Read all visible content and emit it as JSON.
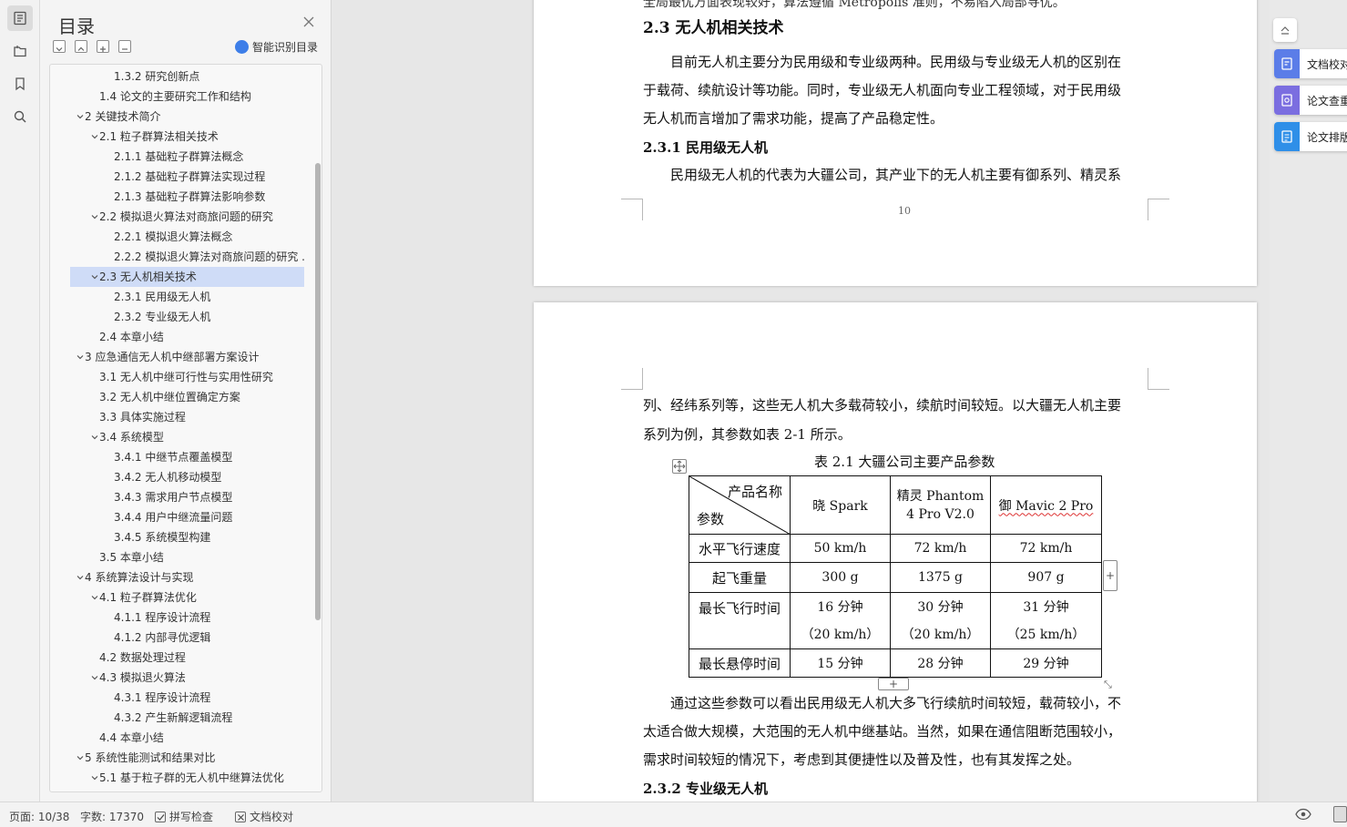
{
  "toc": {
    "title": "目录",
    "smart_label": "智能识别目录",
    "items": [
      {
        "text": "1.3.2 研究创新点",
        "level": 3,
        "arrow": ""
      },
      {
        "text": "1.4 论文的主要研究工作和结构",
        "level": 2,
        "arrow": ""
      },
      {
        "text": "2 关键技术简介",
        "level": 1,
        "arrow": "v"
      },
      {
        "text": "2.1 粒子群算法相关技术",
        "level": 2,
        "arrow": "v"
      },
      {
        "text": "2.1.1 基础粒子群算法概念",
        "level": 3,
        "arrow": ""
      },
      {
        "text": "2.1.2 基础粒子群算法实现过程",
        "level": 3,
        "arrow": ""
      },
      {
        "text": "2.1.3 基础粒子群算法影响参数",
        "level": 3,
        "arrow": ""
      },
      {
        "text": "2.2 模拟退火算法对商旅问题的研究",
        "level": 2,
        "arrow": "v"
      },
      {
        "text": "2.2.1 模拟退火算法概念",
        "level": 3,
        "arrow": ""
      },
      {
        "text": "2.2.2 模拟退火算法对商旅问题的研究 ...",
        "level": 3,
        "arrow": ""
      },
      {
        "text": "2.3 无人机相关技术",
        "level": 2,
        "arrow": "v",
        "active": true
      },
      {
        "text": "2.3.1 民用级无人机",
        "level": 3,
        "arrow": ""
      },
      {
        "text": "2.3.2 专业级无人机",
        "level": 3,
        "arrow": ""
      },
      {
        "text": "2.4 本章小结",
        "level": 2,
        "arrow": ""
      },
      {
        "text": "3 应急通信无人机中继部署方案设计",
        "level": 1,
        "arrow": "v"
      },
      {
        "text": "3.1 无人机中继可行性与实用性研究",
        "level": 2,
        "arrow": ""
      },
      {
        "text": "3.2 无人机中继位置确定方案",
        "level": 2,
        "arrow": ""
      },
      {
        "text": "3.3 具体实施过程",
        "level": 2,
        "arrow": ""
      },
      {
        "text": "3.4 系统模型",
        "level": 2,
        "arrow": "v"
      },
      {
        "text": "3.4.1  中继节点覆盖模型",
        "level": 3,
        "arrow": ""
      },
      {
        "text": "3.4.2 无人机移动模型",
        "level": 3,
        "arrow": ""
      },
      {
        "text": "3.4.3 需求用户节点模型",
        "level": 3,
        "arrow": ""
      },
      {
        "text": "3.4.4  用户中继流量问题",
        "level": 3,
        "arrow": ""
      },
      {
        "text": "3.4.5   系统模型构建",
        "level": 3,
        "arrow": ""
      },
      {
        "text": "3.5 本章小结",
        "level": 2,
        "arrow": ""
      },
      {
        "text": "4 系统算法设计与实现",
        "level": 1,
        "arrow": "v"
      },
      {
        "text": "4.1 粒子群算法优化",
        "level": 2,
        "arrow": "v"
      },
      {
        "text": "4.1.1 程序设计流程",
        "level": 3,
        "arrow": ""
      },
      {
        "text": "4.1.2    内部寻优逻辑",
        "level": 3,
        "arrow": ""
      },
      {
        "text": "4.2 数据处理过程",
        "level": 2,
        "arrow": ""
      },
      {
        "text": "4.3 模拟退火算法",
        "level": 2,
        "arrow": "v"
      },
      {
        "text": "4.3.1 程序设计流程",
        "level": 3,
        "arrow": ""
      },
      {
        "text": "4.3.2 产生新解逻辑流程",
        "level": 3,
        "arrow": ""
      },
      {
        "text": "4.4 本章小结",
        "level": 2,
        "arrow": ""
      },
      {
        "text": "5 系统性能测试和结果对比",
        "level": 1,
        "arrow": "v"
      },
      {
        "text": "5.1 基于粒子群的无人机中继算法优化",
        "level": 2,
        "arrow": "v"
      }
    ]
  },
  "status": {
    "page": "页面: 10/38",
    "words": "字数: 17370",
    "spell": "拼写检查",
    "proof": "文档校对"
  },
  "page1": {
    "top_cut": "全局最优方面表现较好，算法遵循 Metropolis 准则，不易陷入局部寻优。",
    "heading": "2.3 无人机相关技术",
    "para1": [
      "　　目前无人机主要分为民用级和专业级两种。民用级与专业级无人机的区别在",
      "于载荷、续航设计等功能。同时，专业级无人机面向专业工程领域，对于民用级",
      "无人机而言增加了需求功能，提高了产品稳定性。"
    ],
    "sub_heading": "2.3.1 民用级无人机",
    "para2": "　　民用级无人机的代表为大疆公司，其产业下的无人机主要有御系列、精灵系",
    "page_number": "10"
  },
  "page2": {
    "para1": [
      "列、经纬系列等，这些无人机大多载荷较小，续航时间较短。以大疆无人机主要",
      "系列为例，其参数如表 2-1 所示。"
    ],
    "caption": "表  2.1 大疆公司主要产品参数",
    "table": {
      "corner_top": "产品名称",
      "corner_bottom": "参数",
      "headers": [
        "晓 Spark",
        "精灵 Phantom 4 Pro V2.0",
        "御  Mavic 2 Pro"
      ],
      "rows": [
        {
          "label": "水平飞行速度",
          "cells": [
            "50 km/h",
            "72 km/h",
            "72 km/h"
          ]
        },
        {
          "label": "起飞重量",
          "cells": [
            "300 g",
            "1375 g",
            "907 g"
          ]
        },
        {
          "label": "最长飞行时间",
          "cells": [
            "16  分钟",
            "30  分钟",
            "31  分钟"
          ],
          "sub": [
            "（20 km/h）",
            "（20 km/h）",
            "（25 km/h）"
          ]
        },
        {
          "label": "最长悬停时间",
          "cells": [
            "15 分钟",
            "28 分钟",
            "29 分钟"
          ]
        }
      ]
    },
    "para2": [
      "　　通过这些参数可以看出民用级无人机大多飞行续航时间较短，载荷较小，不",
      "太适合做大规模，大范围的无人机中继基站。当然，如果在通信阻断范围较小，",
      "需求时间较短的情况下，考虑到其便捷性以及普及性，也有其发挥之处。"
    ],
    "heading": "2.3.2 专业级无人机"
  },
  "right_tools": [
    {
      "label": "文档校对",
      "color": "#5b7de8"
    },
    {
      "label": "论文查重",
      "color": "#7b6ee0"
    },
    {
      "label": "论文排版",
      "color": "#2f8fe8"
    }
  ]
}
